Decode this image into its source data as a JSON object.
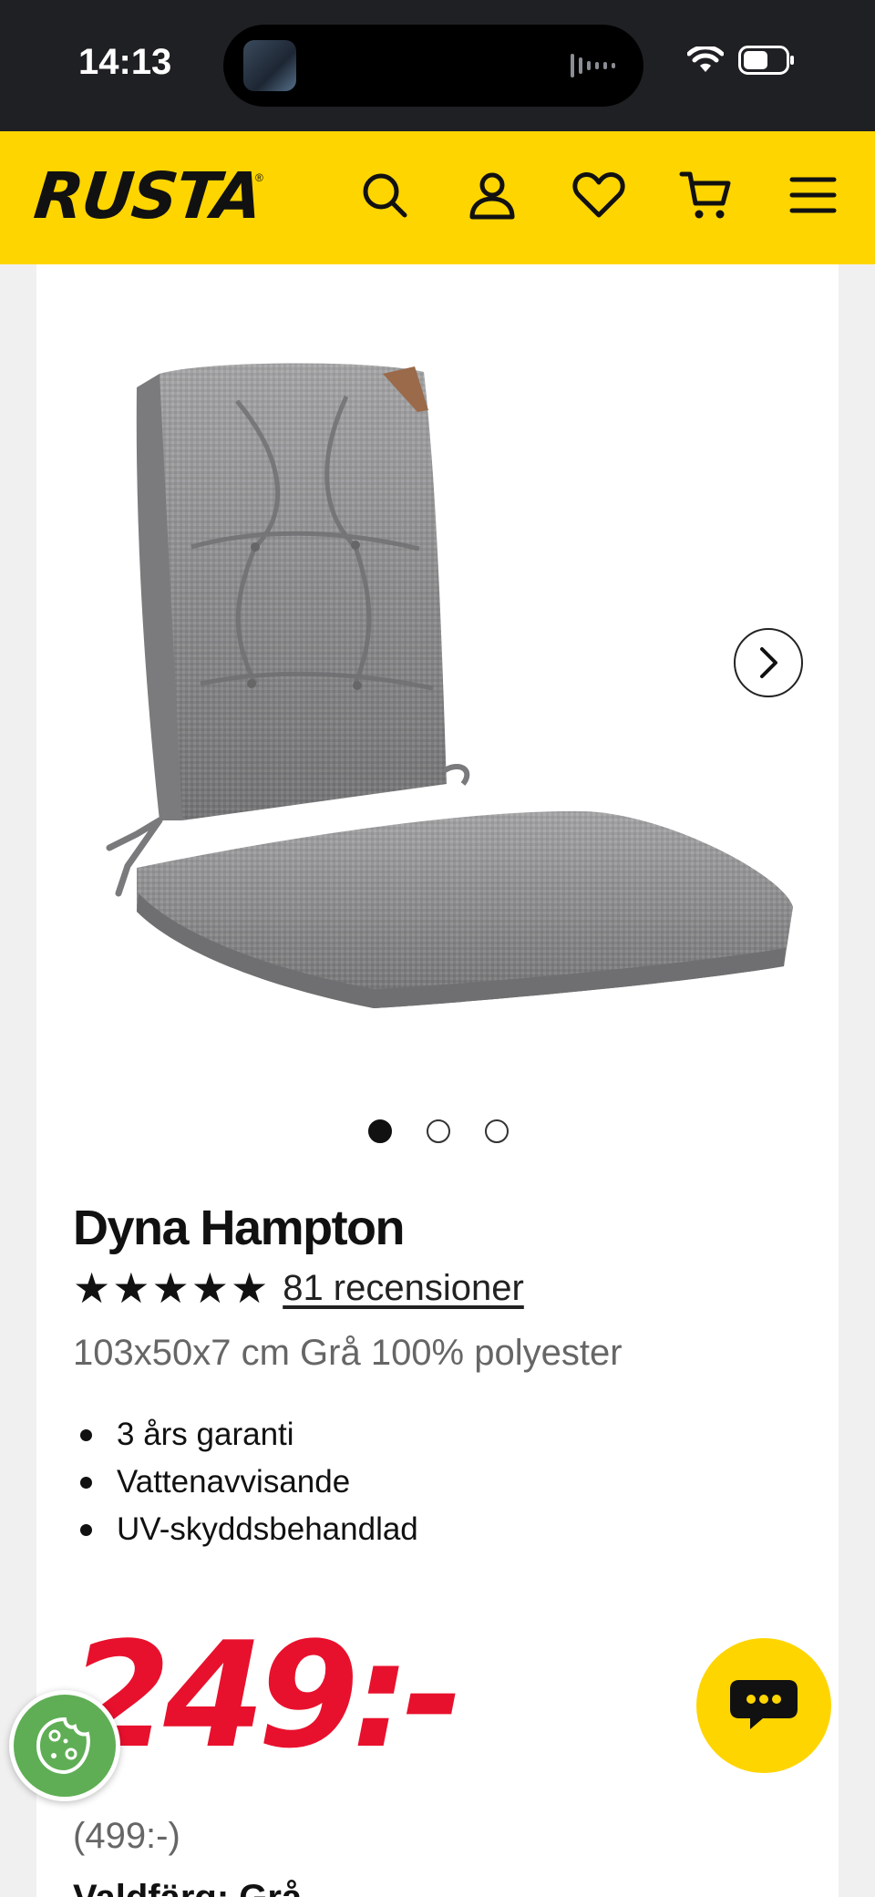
{
  "status_bar": {
    "time": "14:13"
  },
  "header": {
    "logo": "RUSTA",
    "icons": [
      "search-icon",
      "account-icon",
      "heart-icon",
      "cart-icon",
      "menu-icon"
    ]
  },
  "product": {
    "title": "Dyna Hampton",
    "rating_stars": "★★★★★",
    "rating_value": 5,
    "reviews": "81 recensioner",
    "subtitle": "103x50x7 cm Grå 100% polyester",
    "features": [
      "3 års garanti",
      "Vattenavvisande",
      "UV-skyddsbehandlad"
    ],
    "price": "249:-",
    "old_price": "(499:-)",
    "partial_text": "Valdfärg: Grå"
  },
  "carousel": {
    "slides": 3,
    "active": 1
  },
  "colors": {
    "brand_yellow": "#ffd500",
    "price_red": "#e8112d",
    "cookie_green": "#5fae55"
  }
}
